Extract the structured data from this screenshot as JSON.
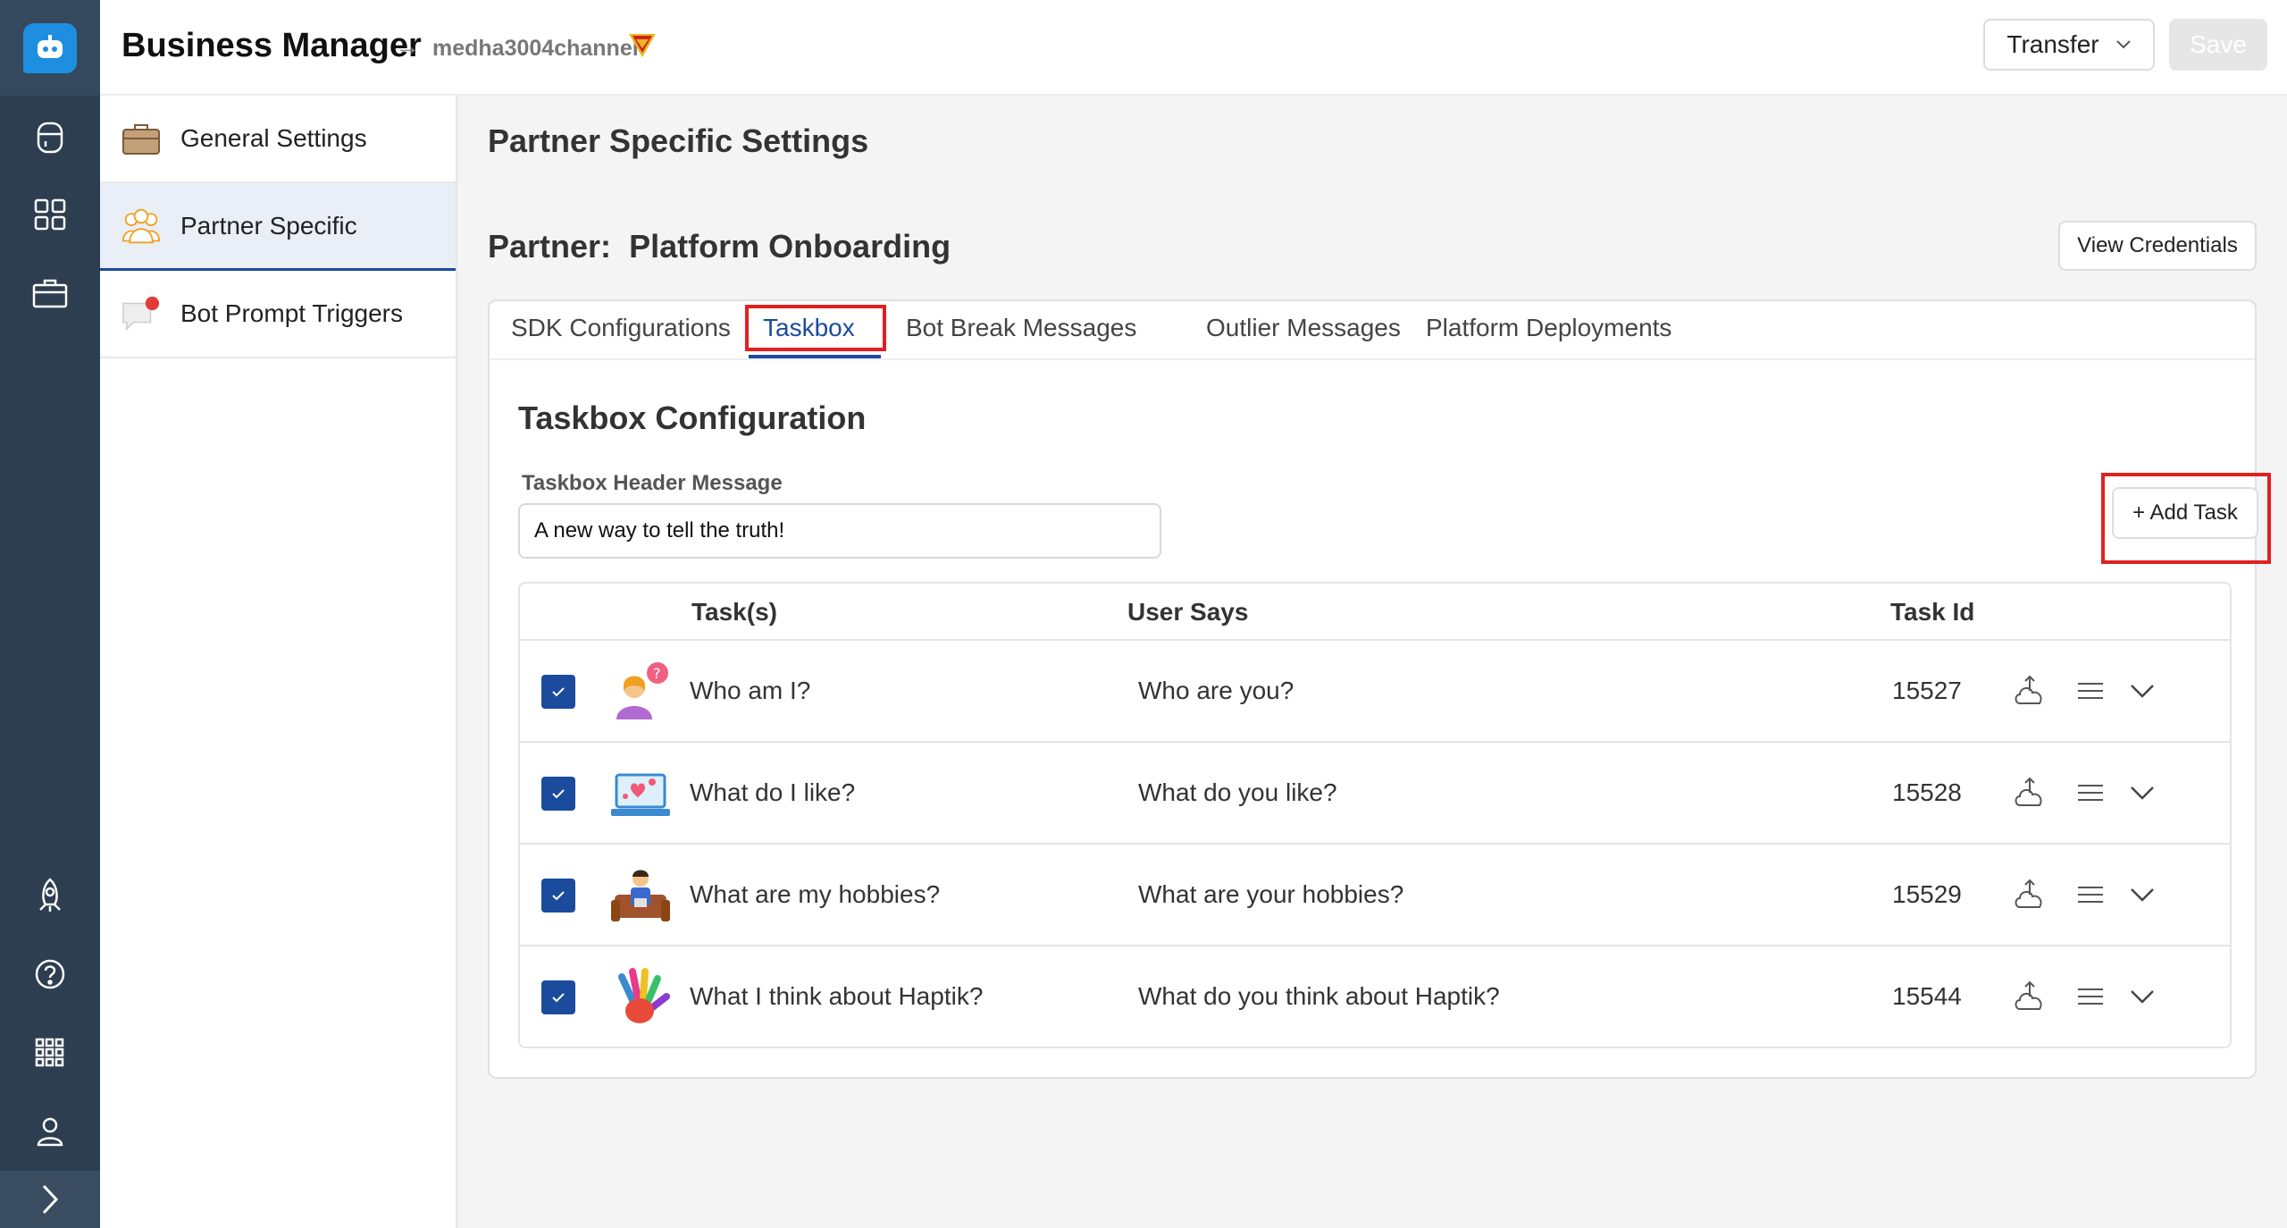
{
  "header": {
    "app_title": "Business Manager",
    "arrow": "→",
    "channel": "medha3004channel",
    "transfer_label": "Transfer",
    "save_label": "Save"
  },
  "rail": {
    "icons": [
      "bot-logo-icon",
      "database-icon",
      "grid-icon",
      "briefcase-icon",
      "rocket-icon",
      "help-icon",
      "apps-icon",
      "user-icon",
      "expand-icon"
    ]
  },
  "subsidebar": {
    "items": [
      {
        "label": "General Settings",
        "icon": "briefcase-icon"
      },
      {
        "label": "Partner Specific",
        "icon": "people-icon"
      },
      {
        "label": "Bot Prompt Triggers",
        "icon": "chat-bubble-icon"
      }
    ]
  },
  "main": {
    "page_title": "Partner Specific Settings",
    "partner_prefix": "Partner:",
    "partner_name": "Platform Onboarding",
    "view_credentials": "View Credentials"
  },
  "tabs": [
    {
      "label": "SDK Configurations"
    },
    {
      "label": "Taskbox"
    },
    {
      "label": "Bot Break Messages"
    },
    {
      "label": "Outlier Messages"
    },
    {
      "label": "Platform Deployments"
    }
  ],
  "taskbox": {
    "title": "Taskbox Configuration",
    "header_label": "Taskbox Header Message",
    "header_value": "A new way to tell the truth!",
    "add_task": "+ Add Task",
    "columns": {
      "tasks": "Task(s)",
      "user_says": "User Says",
      "task_id": "Task Id"
    },
    "rows": [
      {
        "task": "Who am I?",
        "user_says": "Who are you?",
        "task_id": "15527",
        "icon": "person-question-icon"
      },
      {
        "task": "What do I like?",
        "user_says": "What do you like?",
        "task_id": "15528",
        "icon": "laptop-hearts-icon"
      },
      {
        "task": "What are my hobbies?",
        "user_says": "What are your hobbies?",
        "task_id": "15529",
        "icon": "person-couch-icon"
      },
      {
        "task": "What I think about Haptik?",
        "user_says": "What do you think about Haptik?",
        "task_id": "15544",
        "icon": "colorful-hand-icon"
      }
    ]
  },
  "colors": {
    "rail": "#2c3e50",
    "accent": "#1b4b9c",
    "highlight": "#e02020",
    "logo": "#1e8fe0"
  }
}
